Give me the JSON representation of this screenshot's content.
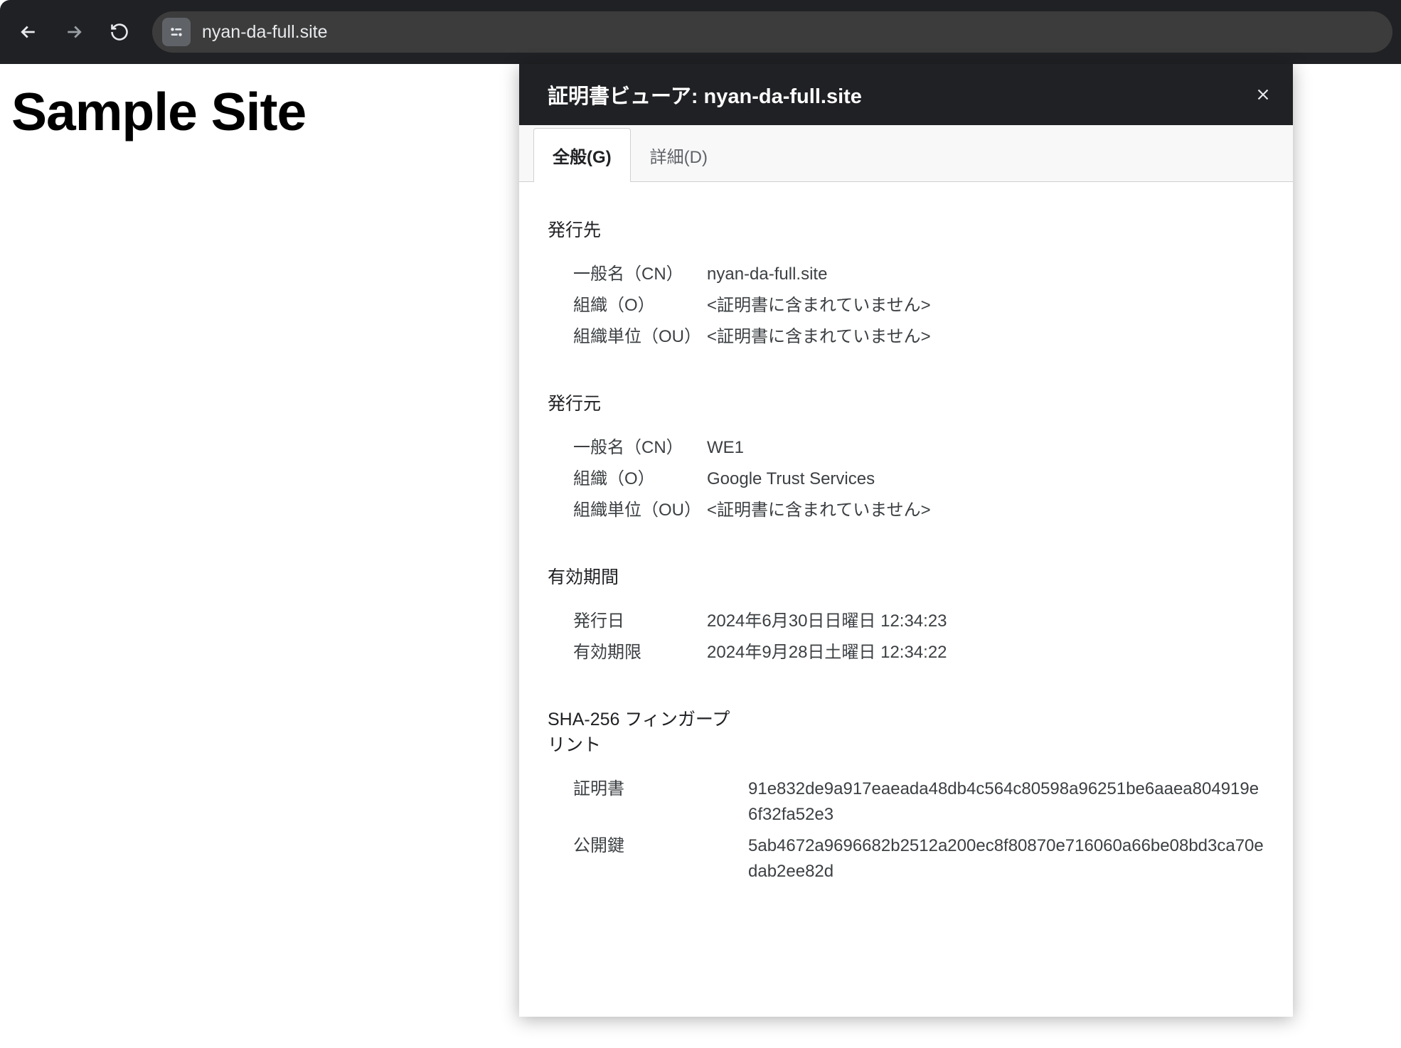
{
  "browser": {
    "url": "nyan-da-full.site"
  },
  "page": {
    "heading": "Sample Site"
  },
  "cert": {
    "title": "証明書ビューア: nyan-da-full.site",
    "tabs": {
      "general": "全般(G)",
      "details": "詳細(D)"
    },
    "issued_to": {
      "heading": "発行先",
      "cn_label": "一般名（CN）",
      "cn_value": "nyan-da-full.site",
      "o_label": "組織（O）",
      "o_value": "<証明書に含まれていません>",
      "ou_label": "組織単位（OU）",
      "ou_value": "<証明書に含まれていません>"
    },
    "issued_by": {
      "heading": "発行元",
      "cn_label": "一般名（CN）",
      "cn_value": "WE1",
      "o_label": "組織（O）",
      "o_value": "Google Trust Services",
      "ou_label": "組織単位（OU）",
      "ou_value": "<証明書に含まれていません>"
    },
    "validity": {
      "heading": "有効期間",
      "issued_label": "発行日",
      "issued_value": "2024年6月30日日曜日 12:34:23",
      "expires_label": "有効期限",
      "expires_value": "2024年9月28日土曜日 12:34:22"
    },
    "fingerprints": {
      "heading": "SHA-256 フィンガープリント",
      "cert_label": "証明書",
      "cert_value": "91e832de9a917eaeada48db4c564c80598a96251be6aaea804919e6f32fa52e3",
      "key_label": "公開鍵",
      "key_value": "5ab4672a9696682b2512a200ec8f80870e716060a66be08bd3ca70edab2ee82d"
    }
  }
}
